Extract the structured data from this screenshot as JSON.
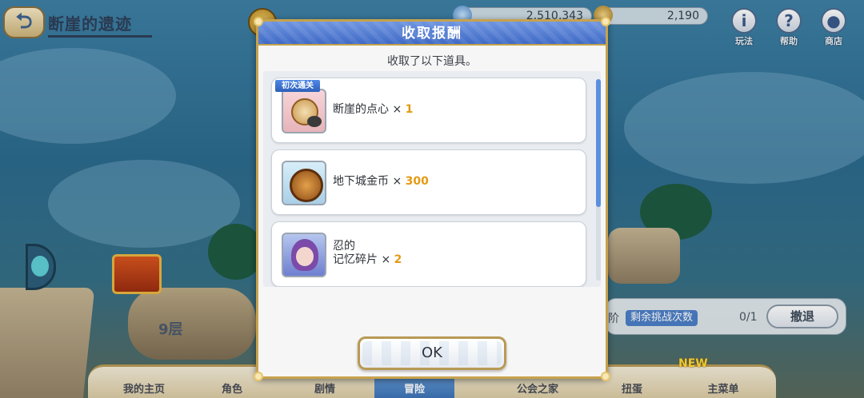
{
  "header": {
    "back_icon": "back-arrow-icon",
    "title": "断崖的遗迹",
    "jewels": "2,510,343",
    "mana": "2,190",
    "buttons": [
      {
        "icon": "info-icon",
        "glyph": "i",
        "label": "玩法"
      },
      {
        "icon": "help-icon",
        "glyph": "?",
        "label": "帮助"
      },
      {
        "icon": "shop-icon",
        "glyph": "●",
        "label": "商店"
      }
    ]
  },
  "scene": {
    "floor_label": "9层"
  },
  "stage_panel": {
    "prefix": "阶",
    "remaining_label": "剩余挑战次数",
    "count": "0/1",
    "retreat_label": "撤退"
  },
  "bottom_nav": {
    "new_badge": "NEW",
    "items": [
      {
        "label": "我的主页",
        "active": false
      },
      {
        "label": "角色",
        "active": false
      },
      {
        "label": "剧情",
        "active": false
      },
      {
        "label": "冒险",
        "active": true
      },
      {
        "label": "公会之家",
        "active": false
      },
      {
        "label": "扭蛋",
        "active": false
      },
      {
        "label": "主菜单",
        "active": false
      }
    ]
  },
  "dialog": {
    "title": "收取报酬",
    "subtitle": "收取了以下道具。",
    "rewards": [
      {
        "icon": "cliff-snack-icon",
        "badge": "初次通关",
        "name_line1": "断崖的点心",
        "name_line2": "",
        "times": "×",
        "qty": "1"
      },
      {
        "icon": "dungeon-coin-icon",
        "badge": "",
        "name_line1": "地下城金币",
        "name_line2": "",
        "times": "×",
        "qty": "300"
      },
      {
        "icon": "memory-shard-icon",
        "badge": "",
        "name_line1": "忍的",
        "name_line2": "记忆碎片",
        "times": "×",
        "qty": "2"
      }
    ],
    "ok_label": "OK"
  },
  "colors": {
    "header_blue": "#3f6ac6",
    "gold_border": "#c7a24d",
    "quantity_orange": "#e49a13",
    "scroll_thumb": "#5b8fe0"
  }
}
